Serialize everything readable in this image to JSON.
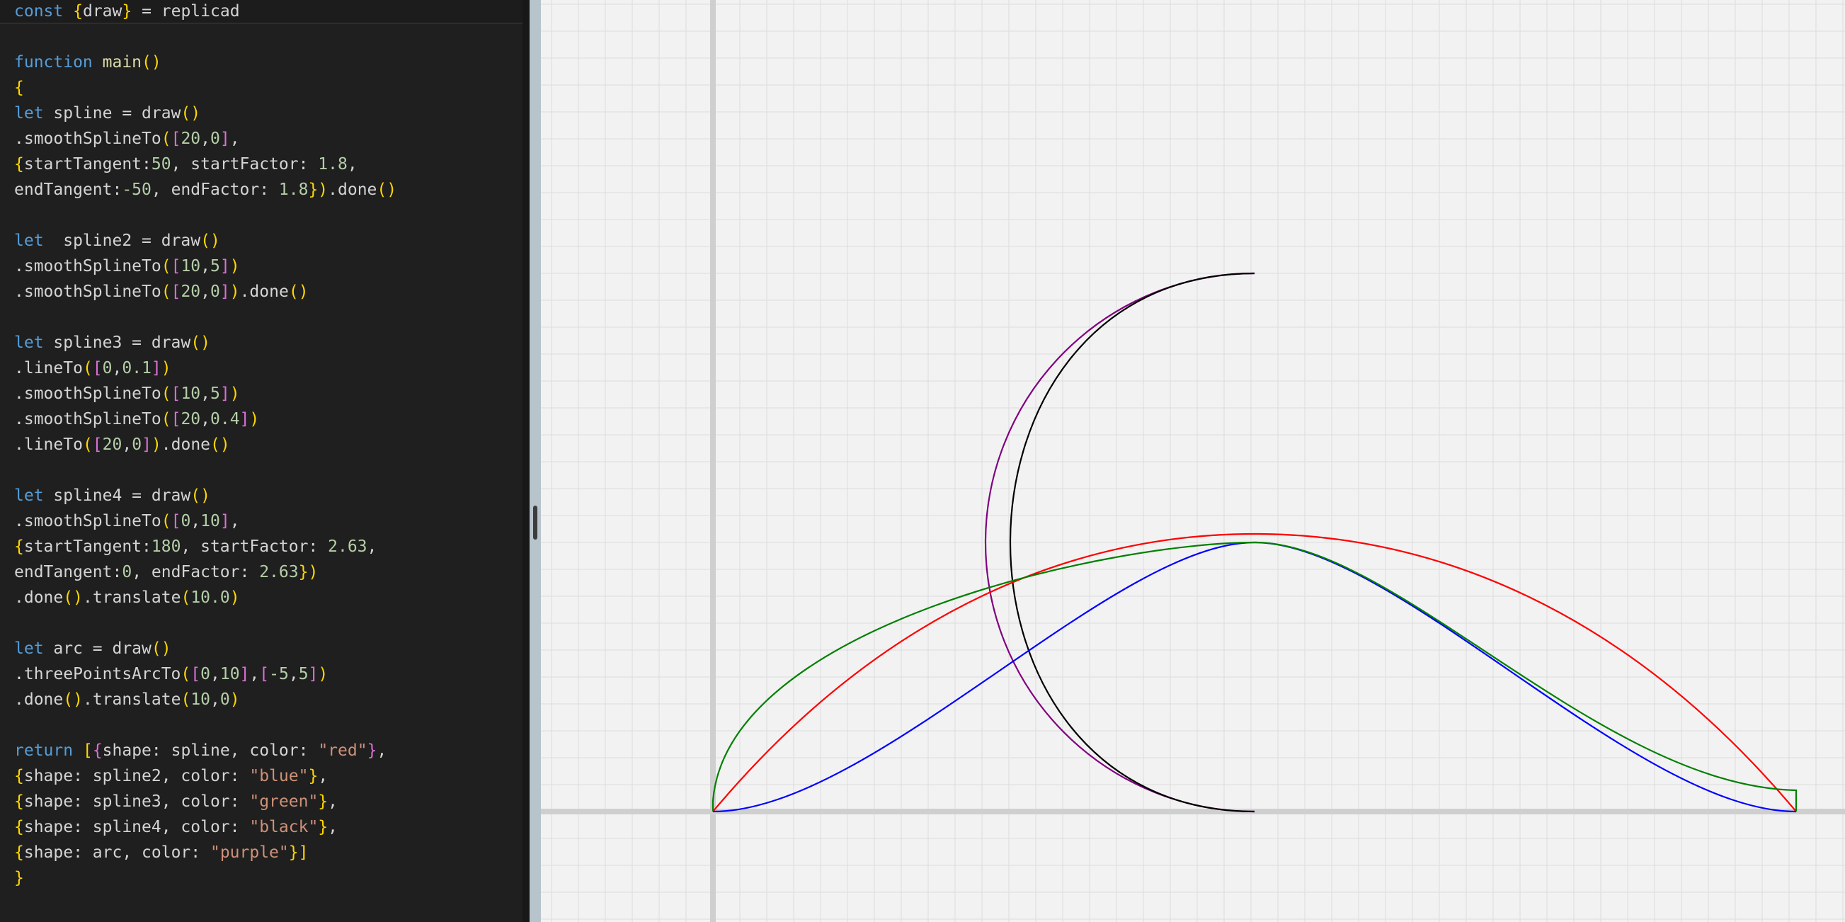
{
  "editor": {
    "lines": [
      "const {draw} = replicad",
      "",
      "function main()",
      "{",
      "let spline = draw()",
      ".smoothSplineTo([20,0],",
      "{startTangent:50, startFactor: 1.8,",
      "endTangent:-50, endFactor: 1.8}).done()",
      "",
      "let  spline2 = draw()",
      ".smoothSplineTo([10,5])",
      ".smoothSplineTo([20,0]).done()",
      "",
      "let spline3 = draw()",
      ".lineTo([0,0.1])",
      ".smoothSplineTo([10,5])",
      ".smoothSplineTo([20,0.4])",
      ".lineTo([20,0]).done()",
      "",
      "let spline4 = draw()",
      ".smoothSplineTo([0,10],",
      "{startTangent:180, startFactor: 2.63,",
      "endTangent:0, endFactor: 2.63})",
      ".done().translate(10.0)",
      "",
      "let arc = draw()",
      ".threePointsArcTo([0,10],[-5,5])",
      ".done().translate(10,0)",
      "",
      "return [{shape: spline, color: \"red\"},",
      "{shape: spline2, color: \"blue\"},",
      "{shape: spline3, color: \"green\"},",
      "{shape: spline4, color: \"black\"},",
      "{shape: arc, color: \"purple\"}]",
      "}"
    ]
  },
  "viewer": {
    "shapes": [
      {
        "name": "spline",
        "color": "red"
      },
      {
        "name": "spline2",
        "color": "blue"
      },
      {
        "name": "spline3",
        "color": "green"
      },
      {
        "name": "spline4",
        "color": "black"
      },
      {
        "name": "arc",
        "color": "purple"
      }
    ]
  },
  "colors": {
    "editor_bg": "#1f1f1f",
    "keyword": "#569cd6",
    "function": "#dcdcaa",
    "number": "#b5cea8",
    "string": "#ce9178",
    "bracket_level1": "#ffd700",
    "bracket_level2": "#da70d6",
    "bracket_level3": "#179fff",
    "viewer_bg": "#f2f2f2",
    "grid": "#dcdcdc",
    "axis": "#cfcfcf"
  }
}
